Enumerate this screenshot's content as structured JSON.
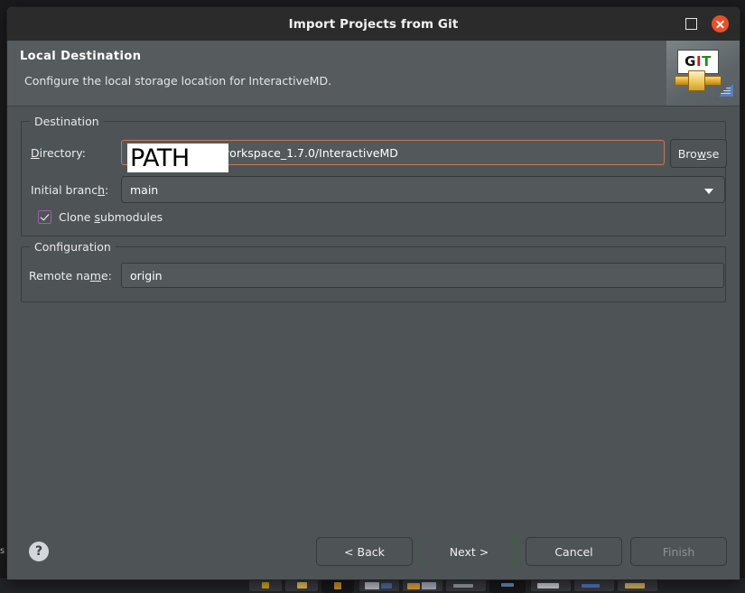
{
  "window": {
    "title": "Import Projects from Git",
    "maximize_icon": "maximize-icon",
    "close_icon": "close-icon"
  },
  "header": {
    "title": "Local Destination",
    "subtitle": "Configure the local storage location for InteractiveMD.",
    "banner_logo": {
      "name": "git-logo-icon",
      "text_g": "G",
      "text_i": "I",
      "text_t": "T"
    }
  },
  "destination": {
    "group_label": "Destination",
    "directory": {
      "label": "Directory:",
      "label_mnemonic": "D",
      "label_rest": "irectory:",
      "value": "STM32CubeIDE/workspace_1.7.0/InteractiveMD",
      "redaction_overlay": "PATH",
      "border_color": "#c77a55"
    },
    "browse_button": {
      "prefix": "Bro",
      "mnemonic": "w",
      "suffix": "se"
    },
    "initial_branch": {
      "label_prefix": "Initial branc",
      "label_mnemonic": "h",
      "label_suffix": ":",
      "value": "main",
      "chevron_icon": "chevron-down-icon"
    },
    "clone_submodules": {
      "label_prefix": "Clone ",
      "label_mnemonic": "s",
      "label_suffix": "ubmodules",
      "checked": true,
      "checkbox_accent": "#a05fa8"
    }
  },
  "configuration": {
    "group_label": "Configuration",
    "remote_name": {
      "label_prefix": "Remote na",
      "label_mnemonic": "m",
      "label_suffix": "e:",
      "value": "origin"
    }
  },
  "footer": {
    "help_icon": "?",
    "buttons": [
      {
        "label": "< Back",
        "state": "enabled"
      },
      {
        "label": "Next >",
        "state": "focused"
      },
      {
        "label": "Cancel",
        "state": "enabled"
      },
      {
        "label": "Finish",
        "state": "disabled"
      }
    ],
    "focus_color": "#2f6b33"
  },
  "desktop": {
    "edge_text": "s"
  }
}
